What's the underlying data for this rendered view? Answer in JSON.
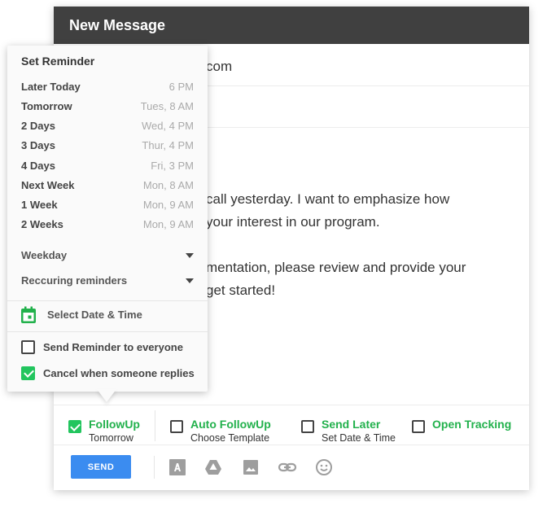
{
  "compose": {
    "title": "New Message",
    "to_visible": "com",
    "body_lines": [
      "call yesterday. I want to emphasize how",
      "your interest in our program.",
      "mentation, please review and provide your",
      "get started!"
    ]
  },
  "options": [
    {
      "label": "FollowUp",
      "sub": "Tomorrow",
      "checked": true
    },
    {
      "label": "Auto FollowUp",
      "sub": "Choose Template",
      "checked": false
    },
    {
      "label": "Send Later",
      "sub": "Set Date & Time",
      "checked": false
    },
    {
      "label": "Open Tracking",
      "sub": "",
      "checked": false
    }
  ],
  "toolbar": {
    "send_label": "SEND",
    "icons": [
      "text-format-icon",
      "drive-icon",
      "image-icon",
      "link-icon",
      "emoji-icon"
    ]
  },
  "reminder_popup": {
    "title": "Set Reminder",
    "items": [
      {
        "name": "Later Today",
        "time": "6 PM"
      },
      {
        "name": "Tomorrow",
        "time": "Tues,  8 AM"
      },
      {
        "name": "2 Days",
        "time": "Wed, 4 PM"
      },
      {
        "name": "3 Days",
        "time": "Thur, 4 PM"
      },
      {
        "name": "4 Days",
        "time": "Fri, 3 PM"
      },
      {
        "name": "Next Week",
        "time": "Mon, 8 AM"
      },
      {
        "name": "1 Week",
        "time": "Mon, 9 AM"
      },
      {
        "name": "2 Weeks",
        "time": "Mon, 9 AM"
      }
    ],
    "weekday_label": "Weekday",
    "recurring_label": "Reccuring reminders",
    "select_date_label": "Select Date & Time",
    "send_to_everyone_label": "Send Reminder to everyone",
    "send_to_everyone_checked": false,
    "cancel_on_reply_label": "Cancel when someone replies",
    "cancel_on_reply_checked": true
  },
  "colors": {
    "header_bg": "#404040",
    "accent_green": "#22b14c",
    "send_blue": "#3b8cf0"
  }
}
